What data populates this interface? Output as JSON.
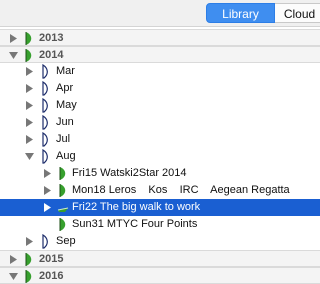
{
  "toolbar": {
    "library_label": "Library",
    "cloud_label": "Cloud"
  },
  "tree": {
    "y2013": "2013",
    "y2014": "2014",
    "months": {
      "mar": "Mar",
      "apr": "Apr",
      "may": "May",
      "jun": "Jun",
      "jul": "Jul",
      "aug": "Aug",
      "sep": "Sep"
    },
    "aug_items": {
      "fri15": "Fri15 Watski2Star 2014",
      "mon18": "Mon18 Leros    Kos    IRC    Aegean Regatta",
      "fri22": "Fri22 The big walk to work",
      "sun31": "Sun31 MTYC Four Points"
    },
    "y2015": "2015",
    "y2016": "2016"
  },
  "colors": {
    "accent": "#3f8ef0",
    "selection": "#1a5fd2",
    "leaf_green": "#37a02e",
    "sail_navy": "#1d2d6b"
  }
}
